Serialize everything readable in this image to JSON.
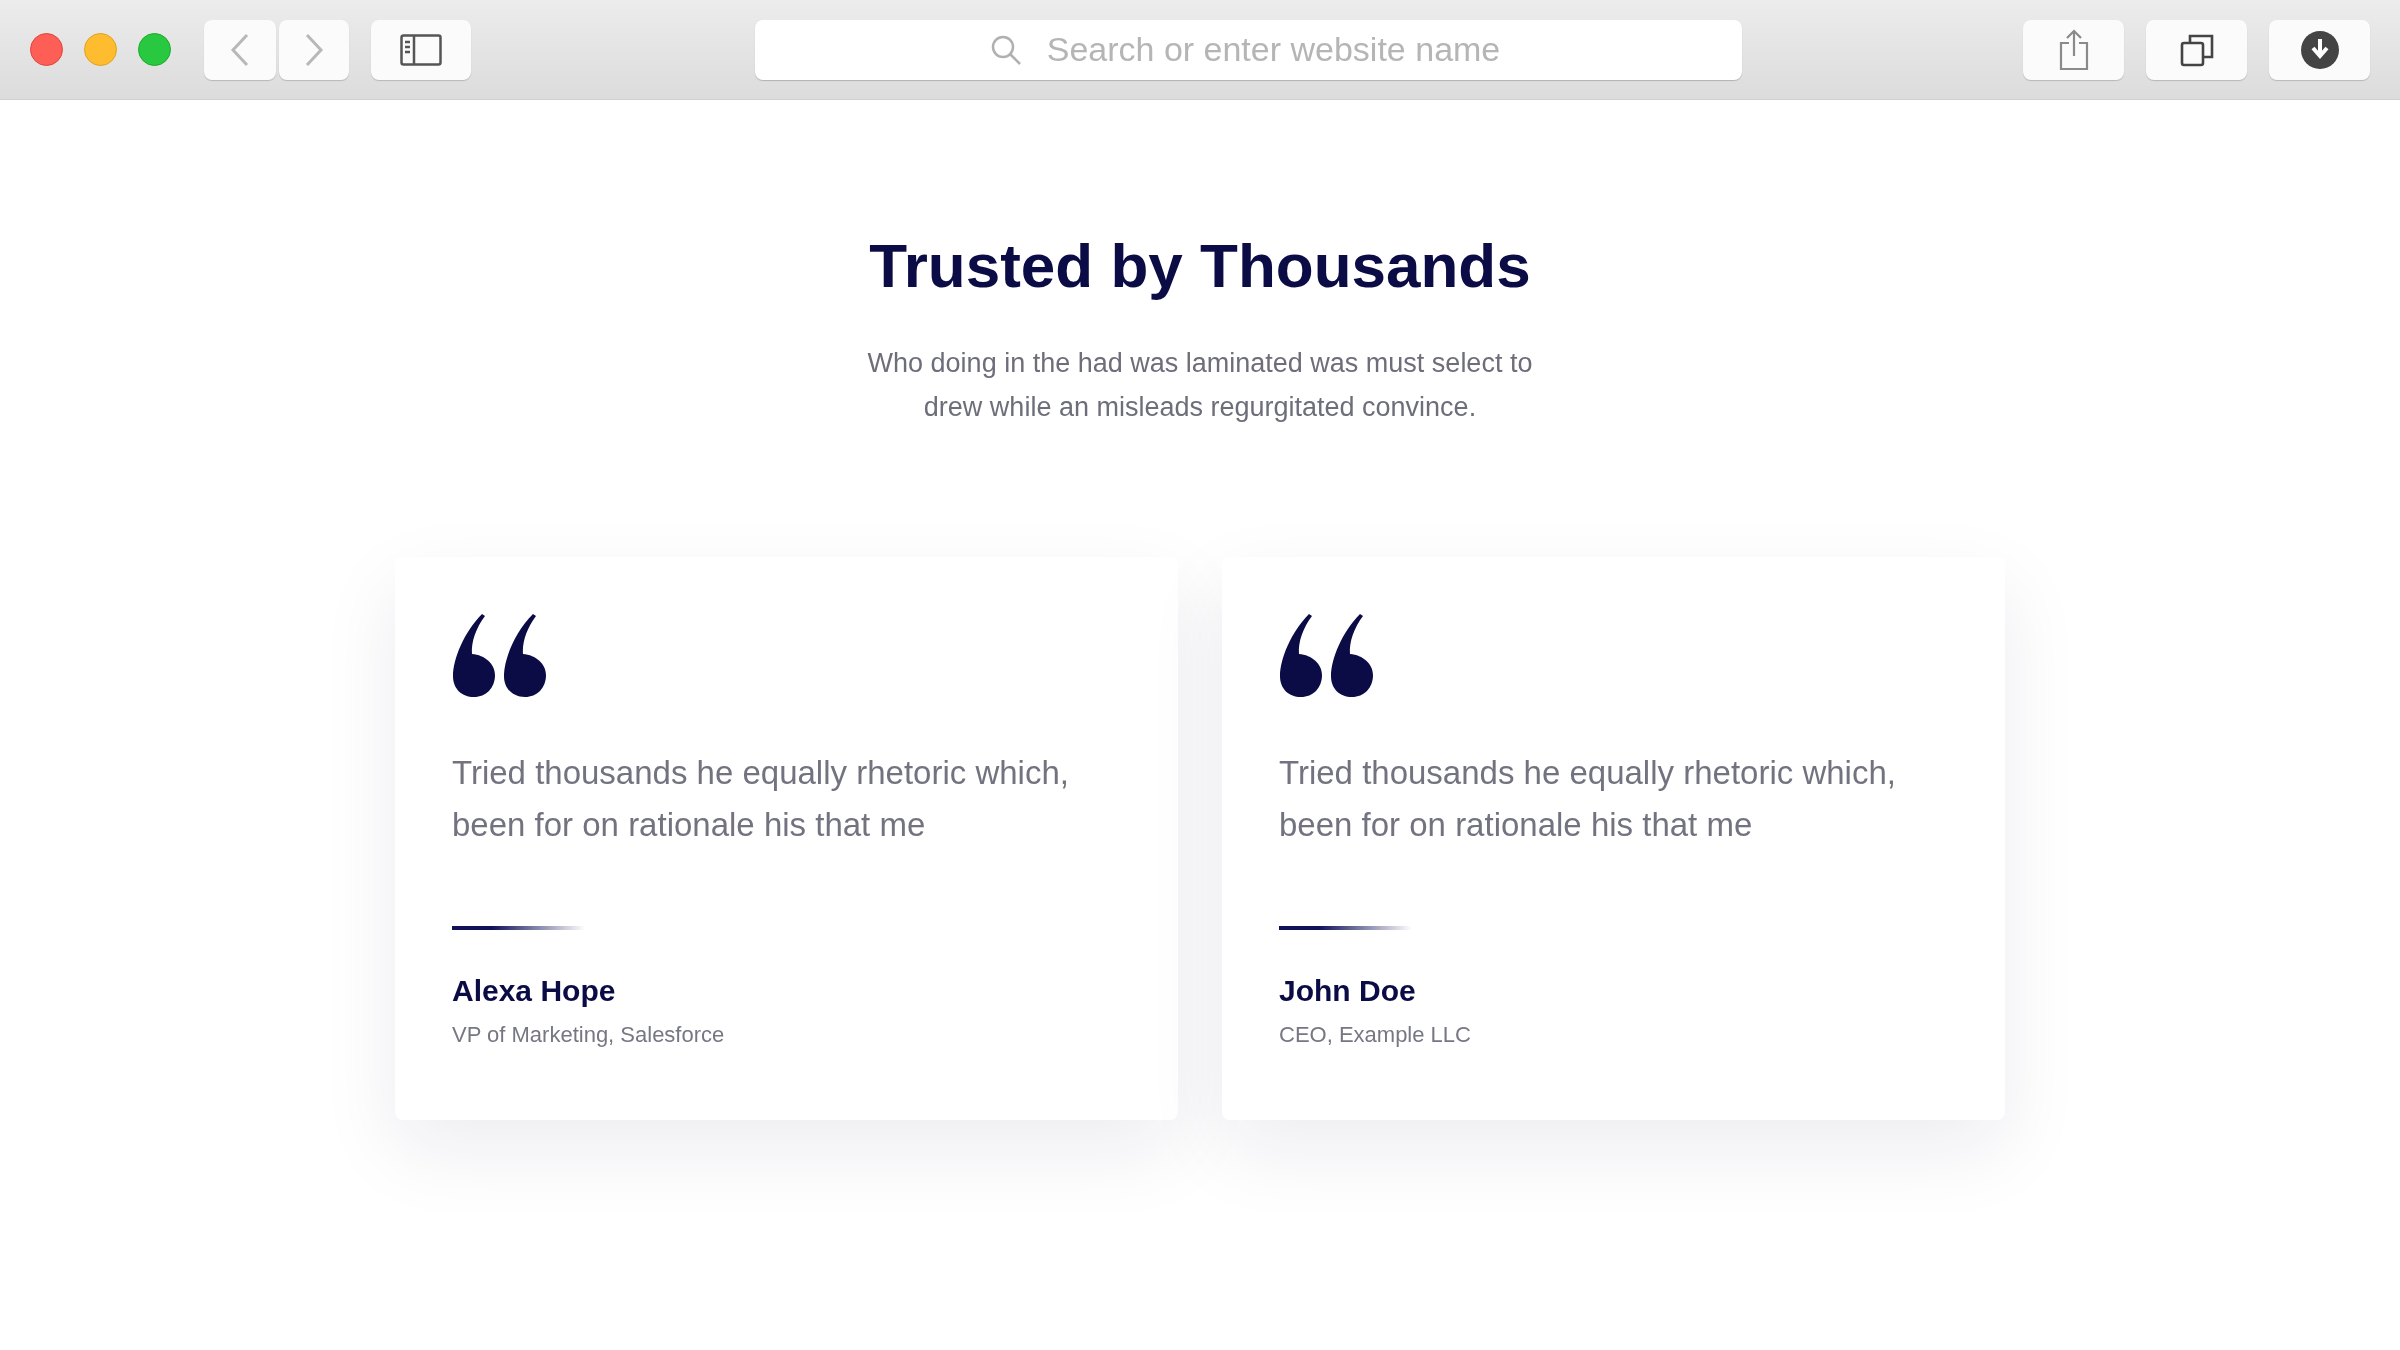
{
  "browser": {
    "search": {
      "placeholder": "Search or enter website name"
    }
  },
  "heading": "Trusted by Thousands",
  "subtitle": "Who doing in the had was laminated was must select to drew while an misleads regurgitated convince.",
  "testimonials": [
    {
      "quote": "Tried thousands he equally rhetoric which, been for on rationale his that me",
      "name": "Alexa Hope",
      "role": "VP of Marketing, Salesforce"
    },
    {
      "quote": "Tried thousands he equally rhetoric which, been for on rationale his that me",
      "name": "John Doe",
      "role": "CEO, Example LLC"
    }
  ]
}
